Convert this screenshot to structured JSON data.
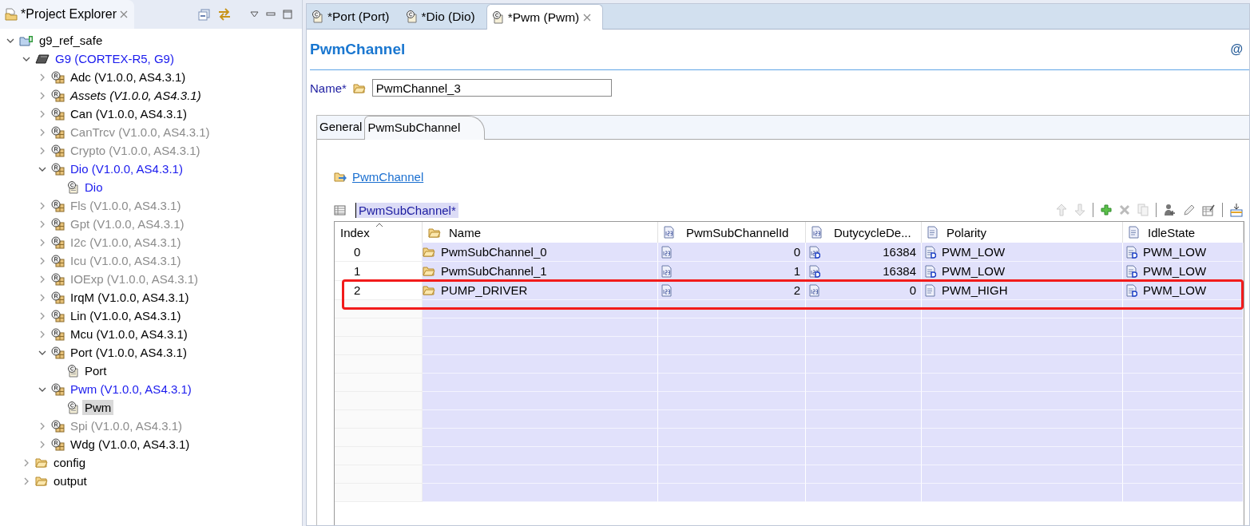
{
  "explorer": {
    "title": "*Project Explorer",
    "tree": [
      {
        "label": "g9_ref_safe",
        "kind": "project",
        "disabled": false,
        "highlighted": false,
        "selected": false,
        "expanded": true,
        "children": [
          {
            "label": "G9 (CORTEX-R5, G9)",
            "kind": "chip",
            "disabled": false,
            "highlighted": true,
            "selected": false,
            "expanded": true,
            "children": [
              {
                "label": "Adc (V1.0.0, AS4.3.1)",
                "kind": "module",
                "disabled": false,
                "highlighted": false,
                "selected": false,
                "expanded": false
              },
              {
                "label": "Assets (V1.0.0, AS4.3.1)",
                "kind": "readonly_module",
                "disabled": false,
                "highlighted": false,
                "selected": false,
                "expanded": false
              },
              {
                "label": "Can (V1.0.0, AS4.3.1)",
                "kind": "module",
                "disabled": false,
                "highlighted": false,
                "selected": false,
                "expanded": false
              },
              {
                "label": "CanTrcv (V1.0.0, AS4.3.1)",
                "kind": "module",
                "disabled": true,
                "highlighted": false,
                "selected": false,
                "expanded": false
              },
              {
                "label": "Crypto (V1.0.0, AS4.3.1)",
                "kind": "module",
                "disabled": true,
                "highlighted": false,
                "selected": false,
                "expanded": false
              },
              {
                "label": "Dio (V1.0.0, AS4.3.1)",
                "kind": "module",
                "disabled": false,
                "highlighted": true,
                "selected": false,
                "expanded": true,
                "children": [
                  {
                    "label": "Dio",
                    "kind": "config",
                    "disabled": false,
                    "highlighted": true,
                    "selected": false
                  }
                ]
              },
              {
                "label": "Fls (V1.0.0, AS4.3.1)",
                "kind": "module",
                "disabled": true,
                "highlighted": false,
                "selected": false,
                "expanded": false
              },
              {
                "label": "Gpt (V1.0.0, AS4.3.1)",
                "kind": "module",
                "disabled": true,
                "highlighted": false,
                "selected": false,
                "expanded": false
              },
              {
                "label": "I2c (V1.0.0, AS4.3.1)",
                "kind": "module",
                "disabled": true,
                "highlighted": false,
                "selected": false,
                "expanded": false
              },
              {
                "label": "Icu (V1.0.0, AS4.3.1)",
                "kind": "module",
                "disabled": true,
                "highlighted": false,
                "selected": false,
                "expanded": false
              },
              {
                "label": "IOExp (V1.0.0, AS4.3.1)",
                "kind": "module",
                "disabled": true,
                "highlighted": false,
                "selected": false,
                "expanded": false
              },
              {
                "label": "IrqM (V1.0.0, AS4.3.1)",
                "kind": "module",
                "disabled": false,
                "highlighted": false,
                "selected": false,
                "expanded": false
              },
              {
                "label": "Lin (V1.0.0, AS4.3.1)",
                "kind": "module",
                "disabled": false,
                "highlighted": false,
                "selected": false,
                "expanded": false
              },
              {
                "label": "Mcu (V1.0.0, AS4.3.1)",
                "kind": "module",
                "disabled": false,
                "highlighted": false,
                "selected": false,
                "expanded": false
              },
              {
                "label": "Port (V1.0.0, AS4.3.1)",
                "kind": "module",
                "disabled": false,
                "highlighted": false,
                "selected": false,
                "expanded": true,
                "children": [
                  {
                    "label": "Port",
                    "kind": "config",
                    "disabled": false,
                    "highlighted": false,
                    "selected": false
                  }
                ]
              },
              {
                "label": "Pwm (V1.0.0, AS4.3.1)",
                "kind": "module",
                "disabled": false,
                "highlighted": true,
                "selected": false,
                "expanded": true,
                "children": [
                  {
                    "label": "Pwm",
                    "kind": "config",
                    "disabled": false,
                    "highlighted": false,
                    "selected": true
                  }
                ]
              },
              {
                "label": "Spi (V1.0.0, AS4.3.1)",
                "kind": "module",
                "disabled": true,
                "highlighted": false,
                "selected": false,
                "expanded": false
              },
              {
                "label": "Wdg (V1.0.0, AS4.3.1)",
                "kind": "module",
                "disabled": false,
                "highlighted": false,
                "selected": false,
                "expanded": false
              }
            ]
          },
          {
            "label": "config",
            "kind": "folder",
            "disabled": false,
            "highlighted": false,
            "selected": false,
            "expanded": false
          },
          {
            "label": "output",
            "kind": "folder",
            "disabled": false,
            "highlighted": false,
            "selected": false,
            "expanded": false
          }
        ]
      }
    ]
  },
  "editor_tabs": [
    {
      "label": "*Port (Port)",
      "selected": false
    },
    {
      "label": "*Dio (Dio)",
      "selected": false
    },
    {
      "label": "*Pwm (Pwm)",
      "selected": true
    }
  ],
  "form": {
    "title": "PwmChannel",
    "help_mark": "@",
    "name_label": "Name*",
    "name_value": "PwmChannel_3",
    "tabs": [
      {
        "label": "General",
        "selected": false
      },
      {
        "label": "PwmSubChannel",
        "selected": true
      }
    ],
    "parent_link": "PwmChannel",
    "table_title": "PwmSubChannel*"
  },
  "table": {
    "columns": [
      "Index",
      "Name",
      "PwmSubChannelId",
      "DutycycleDe...",
      "Polarity",
      "IdleState"
    ],
    "rows": [
      {
        "highlighted": false,
        "cells": [
          {
            "value": "0"
          },
          {
            "value": "PwmSubChannel_0"
          },
          {
            "value": "0",
            "default": false
          },
          {
            "value": "16384",
            "default": true
          },
          {
            "value": "PWM_LOW",
            "default": true
          },
          {
            "value": "PWM_LOW",
            "default": true
          }
        ]
      },
      {
        "highlighted": false,
        "cells": [
          {
            "value": "1"
          },
          {
            "value": "PwmSubChannel_1"
          },
          {
            "value": "1",
            "default": false
          },
          {
            "value": "16384",
            "default": true
          },
          {
            "value": "PWM_LOW",
            "default": true
          },
          {
            "value": "PWM_LOW",
            "default": true
          }
        ]
      },
      {
        "highlighted": true,
        "cells": [
          {
            "value": "2"
          },
          {
            "value": "PUMP_DRIVER"
          },
          {
            "value": "2",
            "default": false
          },
          {
            "value": "0",
            "default": false
          },
          {
            "value": "PWM_HIGH",
            "default": false
          },
          {
            "value": "PWM_LOW",
            "default": true
          }
        ]
      }
    ]
  }
}
